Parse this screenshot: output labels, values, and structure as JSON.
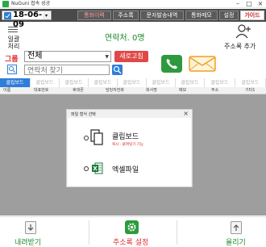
{
  "window": {
    "title": "NuGuni 접속 성공",
    "controls": [
      "–",
      "□",
      "×"
    ]
  },
  "toolbar": {
    "date_value": "18-06-09",
    "tabs": [
      {
        "label": "통화이력",
        "active": true
      },
      {
        "label": "주소록",
        "active": false
      },
      {
        "label": "문자발송내역",
        "active": false
      },
      {
        "label": "통화메모",
        "active": false
      },
      {
        "label": "설정",
        "active": false
      }
    ],
    "guide_label": "가이드"
  },
  "header": {
    "batch_label": "일괄\n처리",
    "contacts_count": "연락처. 0명",
    "add_contact_label": "주소록 추가"
  },
  "filters": {
    "group_label": "그룹",
    "group_value": "전체",
    "refresh_label": "새로고침",
    "search_placeholder": "연락처 찾기"
  },
  "column_tabs": [
    "클립보드",
    "클립보드",
    "클립보드",
    "클립보드",
    "클립보드",
    "클립보드",
    "클립보드",
    "클립보드",
    "클립보드"
  ],
  "columns": [
    "이름",
    "대표번호",
    "휴대폰",
    "담당자전화",
    "회사명",
    "메모",
    "주소",
    "기타1"
  ],
  "dialog": {
    "title": "파일 형식 선택",
    "close": "×",
    "options": [
      {
        "label": "클립보드",
        "note": "복사 - 붙여넣기 기능"
      },
      {
        "label": "엑셀파일",
        "note": ""
      }
    ]
  },
  "bottom": {
    "download_label": "내려받기",
    "settings_label": "주소록 설정",
    "upload_label": "올리기"
  },
  "colors": {
    "toolbar_bg": "#4a4a4a",
    "accent_green": "#1a8a2a",
    "accent_red": "#e04848",
    "accent_blue": "#2f7ed8",
    "body_gray": "#9e9e9e"
  }
}
